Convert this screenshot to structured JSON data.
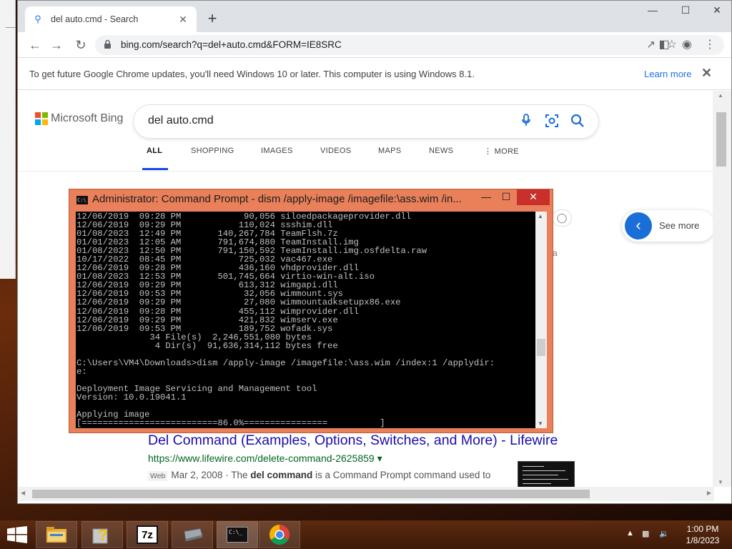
{
  "browser": {
    "tab_title": "del auto.cmd - Search",
    "tab_close": "✕",
    "new_tab": "+",
    "window_controls": {
      "minimize": "—",
      "maximize": "☐",
      "close": "✕"
    },
    "url": "bing.com/search?q=del+auto.cmd&FORM=IE8SRC",
    "infobar": {
      "message": "To get future Google Chrome updates, you'll need Windows 10 or later. This computer is using Windows 8.1.",
      "link": "Learn more",
      "close": "✕"
    }
  },
  "bing": {
    "logo_text": "Microsoft Bing",
    "query": "del auto.cmd",
    "tabs": [
      "ALL",
      "SHOPPING",
      "IMAGES",
      "VIDEOS",
      "MAPS",
      "NEWS",
      "⋮ MORE"
    ],
    "active_tab": "ALL",
    "see_more": "See more",
    "side_letter": "a",
    "result": {
      "title": "Del Command (Examples, Options, Switches, and More) - Lifewire",
      "url": "https://www.lifewire.com/delete-command-2625859 ▾",
      "badge": "Web",
      "snippet_date": "Mar 2, 2008 · The ",
      "snippet_bold": "del command",
      "snippet_rest": " is a Command Prompt command used to"
    }
  },
  "cmd": {
    "title": "Administrator:  Command Prompt - dism  /apply-image /imagefile:\\ass.wim /in...",
    "icon_text": "C:\\",
    "buttons": {
      "minimize": "—",
      "maximize": "☐",
      "close": "✕"
    },
    "lines": [
      "12/06/2019  09:28 PM            90,056 siloedpackageprovider.dll",
      "12/06/2019  09:29 PM           110,024 ssshim.dll",
      "01/08/2023  12:49 PM       140,267,784 TeamFlsh.7z",
      "01/01/2023  12:05 AM       791,674,880 TeamInstall.img",
      "01/08/2023  12:50 PM       791,150,592 TeamInstall.img.osfdelta.raw",
      "10/17/2022  08:45 PM           725,032 vac467.exe",
      "12/06/2019  09:28 PM           436,160 vhdprovider.dll",
      "01/08/2023  12:53 PM       501,745,664 virtio-win-alt.iso",
      "12/06/2019  09:29 PM           613,312 wimgapi.dll",
      "12/06/2019  09:53 PM            32,056 wimmount.sys",
      "12/06/2019  09:29 PM            27,080 wimmountadksetupx86.exe",
      "12/06/2019  09:28 PM           455,112 wimprovider.dll",
      "12/06/2019  09:29 PM           421,832 wimserv.exe",
      "12/06/2019  09:53 PM           189,752 wofadk.sys",
      "              34 File(s)  2,246,551,080 bytes",
      "               4 Dir(s)  91,636,314,112 bytes free",
      "",
      "C:\\Users\\VM4\\Downloads>dism /apply-image /imagefile:\\ass.wim /index:1 /applydir:",
      "e:",
      "",
      "Deployment Image Servicing and Management tool",
      "Version: 10.0.19041.1",
      "",
      "Applying image",
      "[==========================86.0%================          ]"
    ],
    "progress_percent": 86.0
  },
  "taskbar": {
    "apps": [
      "file-explorer",
      "help",
      "7-zip",
      "drive",
      "command-prompt",
      "chrome"
    ],
    "app_glyphs": {
      "help": "?",
      "7-zip": "7z",
      "cmd": "C:\\_"
    },
    "time": "1:00 PM",
    "date": "1/8/2023"
  },
  "colors": {
    "cmd_frame": "#e9805a",
    "link": "#1a0dab",
    "bing_accent": "#174ae4"
  }
}
